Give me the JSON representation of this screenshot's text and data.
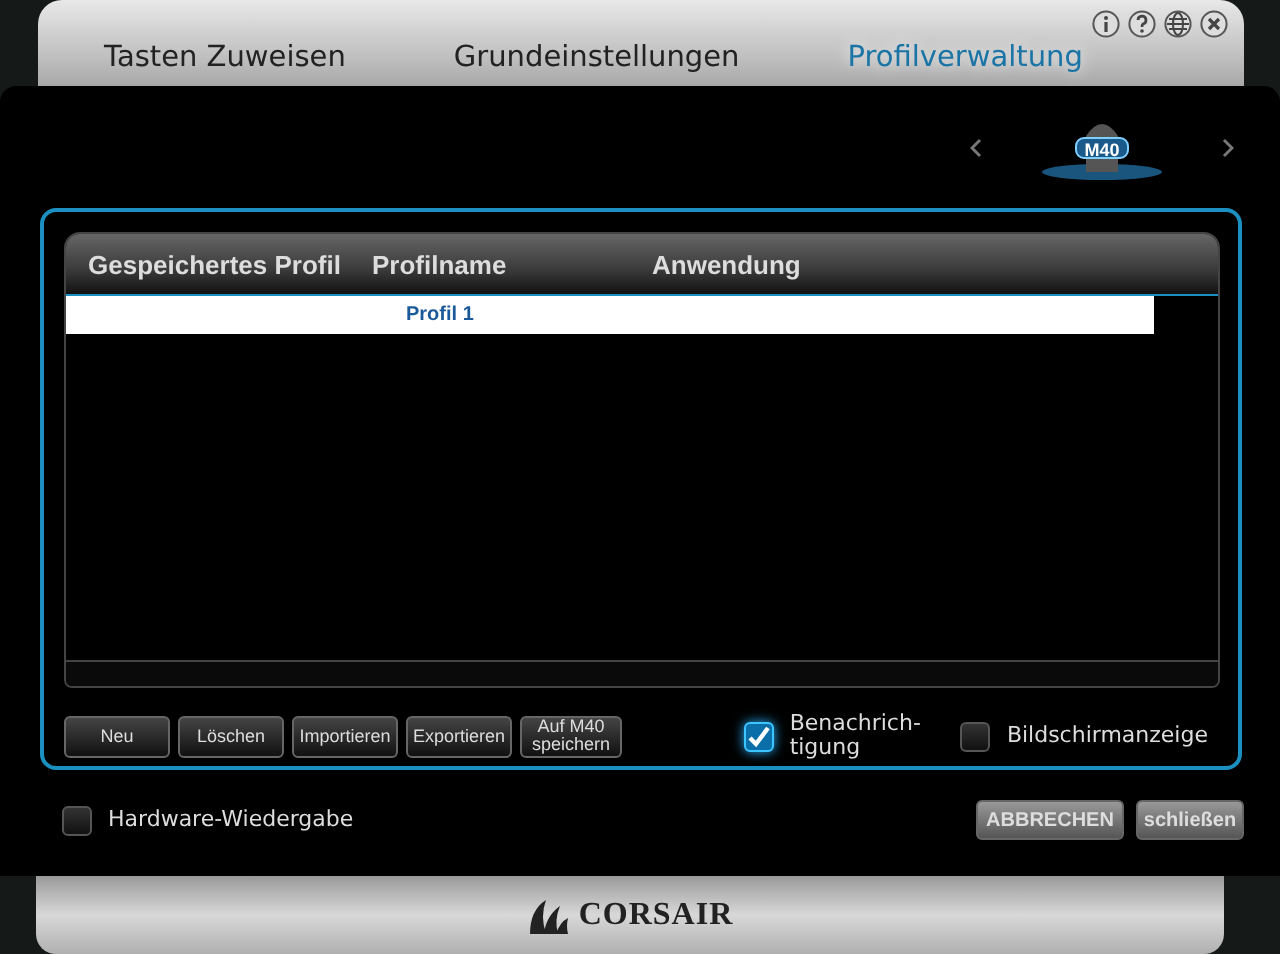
{
  "tabs": [
    {
      "label": "Tasten Zuweisen",
      "selected": false
    },
    {
      "label": "Grundeinstellungen",
      "selected": false
    },
    {
      "label": "Profilverwaltung",
      "selected": true
    }
  ],
  "device": {
    "label": "M40"
  },
  "table": {
    "columns": [
      "Gespeichertes Profil",
      "Profilname",
      "Anwendung"
    ],
    "rows": [
      {
        "profile_name": "Profil 1",
        "selected": true
      }
    ]
  },
  "buttons": [
    "Neu",
    "Löschen",
    "Importieren",
    "Exportieren",
    "Auf M40 speichern"
  ],
  "options": [
    {
      "label": "Benachrich-\ntigung",
      "checked": true
    },
    {
      "label": "Bildschirmanzeige",
      "checked": false
    }
  ],
  "hardware_playback": {
    "label": "Hardware-Wiedergabe",
    "checked": false
  },
  "actions": [
    "ABBRECHEN",
    "schließen"
  ],
  "brand": "CORSAIR"
}
